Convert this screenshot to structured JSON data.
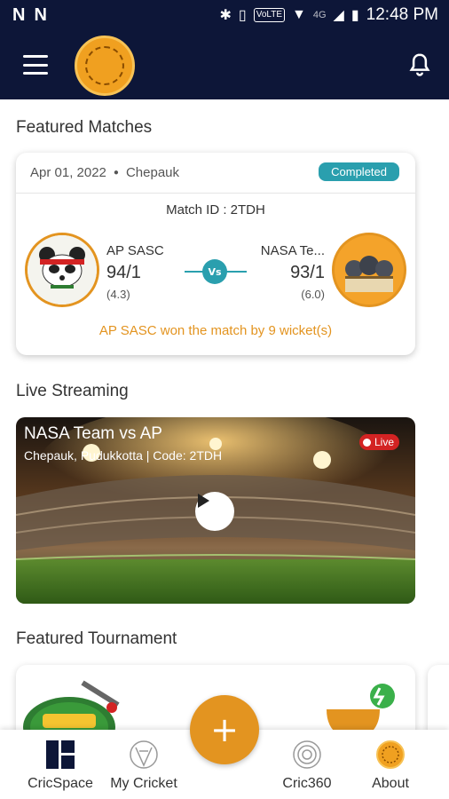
{
  "status_bar": {
    "time": "12:48 PM",
    "network": "4G",
    "volte": "VoLTE"
  },
  "sections": {
    "featured_matches": "Featured Matches",
    "live_streaming": "Live Streaming",
    "featured_tournament": "Featured Tournament"
  },
  "match": {
    "date": "Apr 01, 2022",
    "venue": "Chepauk",
    "status": "Completed",
    "match_id": "Match ID : 2TDH",
    "team1": {
      "name": "AP SASC",
      "score": "94/1",
      "overs": "(4.3)"
    },
    "team2": {
      "name": "NASA Te...",
      "score": "93/1",
      "overs": "(6.0)"
    },
    "vs": "Vs",
    "result": "AP SASC won the match by 9 wicket(s)"
  },
  "stream": {
    "title": "NASA Team vs AP",
    "subtitle": "Chepauk, Pudukkotta | Code: 2TDH",
    "live_label": "Live"
  },
  "nav": {
    "items": [
      {
        "label": "CricSpace",
        "icon": "grid-icon"
      },
      {
        "label": "My Cricket",
        "icon": "lion-icon"
      },
      {
        "label": "Cric360",
        "icon": "radar-icon"
      },
      {
        "label": "About",
        "icon": "info-logo-icon"
      }
    ],
    "fab": "+"
  },
  "colors": {
    "primary": "#0d1638",
    "accent": "#e39420",
    "teal": "#2a9fae",
    "live": "#d32323"
  }
}
